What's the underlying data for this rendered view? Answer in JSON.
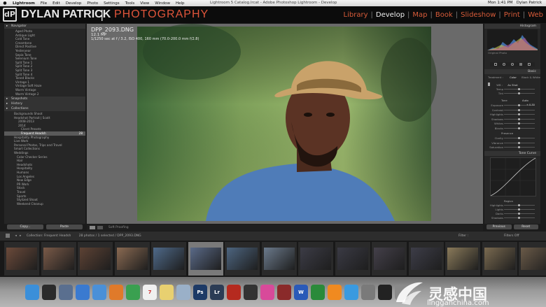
{
  "menubar": {
    "apple": "",
    "items": [
      "Lightroom",
      "File",
      "Edit",
      "Develop",
      "Photo",
      "Settings",
      "Tools",
      "View",
      "Window",
      "Help"
    ],
    "window_title": "Lightroom 5 Catalog.lrcat - Adobe Photoshop Lightroom - Develop",
    "clock": "Mon 1:41 PM",
    "user": "Dylan Patrick"
  },
  "identity_plate": {
    "logo_glyph": "dP",
    "name": "DYLAN PATRICK",
    "separator": "|",
    "subtitle": "PHOTOGRAPHY",
    "accent_color": "#e0553a"
  },
  "modules": [
    {
      "label": "Library",
      "active": false
    },
    {
      "label": "Develop",
      "active": true
    },
    {
      "label": "Map",
      "active": false
    },
    {
      "label": "Book",
      "active": false
    },
    {
      "label": "Slideshow",
      "active": false
    },
    {
      "label": "Print",
      "active": false
    },
    {
      "label": "Web",
      "active": false
    }
  ],
  "left_panel": {
    "navigator_header": "Navigator",
    "presets": [
      "Aged Photo",
      "Antique Light",
      "Cold Tone",
      "Creamtone",
      "Direct Positive",
      "Yesteryear",
      "Sepia Tone",
      "Selenium Tone",
      "Split Tone 1",
      "Split Tone 2",
      "Split Tone 3",
      "Split Tone 4",
      "Toned Blacks",
      "Vintage 1",
      "Vintage Soft Haze",
      "Warm Vintage",
      "Warm Vintage 2"
    ],
    "snapshots_header": "Snapshots",
    "history_header": "History",
    "collections_header": "Collections",
    "collections": [
      {
        "label": "Backgrounds Shoot",
        "count": ""
      },
      {
        "label": "Headshot Portrait | Scott",
        "count": ""
      },
      {
        "label": "2008-2013",
        "count": ""
      },
      {
        "label": "2014",
        "count": ""
      },
      {
        "label": "Client Presets",
        "count": ""
      },
      {
        "label": "Frequent Headsh",
        "count": "28"
      },
      {
        "label": "Hospitality Photography",
        "count": ""
      },
      {
        "label": "Live Work",
        "count": ""
      },
      {
        "label": "Personal Photos, Trips and Travel",
        "count": ""
      },
      {
        "label": "Smart Collections",
        "count": ""
      },
      {
        "label": "Weddings",
        "count": ""
      },
      {
        "label": "Color Checker Series",
        "count": ""
      },
      {
        "label": "Hair",
        "count": ""
      },
      {
        "label": "Headshots",
        "count": ""
      },
      {
        "label": "Hospitality",
        "count": ""
      },
      {
        "label": "Humans",
        "count": ""
      },
      {
        "label": "Los Angeles",
        "count": ""
      },
      {
        "label": "New Edge",
        "count": ""
      },
      {
        "label": "PR Work",
        "count": ""
      },
      {
        "label": "Stock",
        "count": ""
      },
      {
        "label": "Travel",
        "count": ""
      },
      {
        "label": "Sports",
        "count": ""
      },
      {
        "label": "Stylized Shoot",
        "count": ""
      },
      {
        "label": "Weekend Cleanup",
        "count": ""
      }
    ],
    "copy_button": "Copy...",
    "paste_button": "Paste"
  },
  "photo_info": {
    "filename": "DPP_2093.DNG",
    "megapixels": "12.1 MP",
    "exposure": "1/1250 sec at f / 3.2, ISO 400, 160 mm (70.0-200.0 mm f/2.8)"
  },
  "toolbar": {
    "soft_proofing": "Soft Proofing"
  },
  "right_panel": {
    "histogram_header": "Histogram",
    "histogram_caption": "Original Photo",
    "basic_header": "Basic",
    "treatment_label": "Treatment :",
    "color_option": "Color",
    "bw_option": "Black & White",
    "wb_label": "WB :",
    "wb_value": "As Shot",
    "temp_label": "Temp",
    "tint_label": "Tint",
    "tone_label": "Tone",
    "auto_label": "Auto",
    "sliders": [
      "Exposure",
      "Contrast",
      "Highlights",
      "Shadows",
      "Whites",
      "Blacks"
    ],
    "exposure_value": "+ 0.30",
    "presence_label": "Presence",
    "presence_sliders": [
      "Clarity",
      "Vibrance",
      "Saturation"
    ],
    "tone_curve_header": "Tone Curve",
    "region_label": "Region",
    "region_sliders": [
      "Highlights",
      "Lights",
      "Darks",
      "Shadows"
    ],
    "previous_button": "Previous",
    "reset_button": "Reset"
  },
  "filmstrip": {
    "source": "Collection: Frequent Headsh",
    "count_text": "28 photos / 1 selected / DPP_2093.DNG",
    "filter_label": "Filter :",
    "filter_value": "Filters Off",
    "thumbnail_count": 15,
    "selected_index": 5
  },
  "dock": {
    "icons": [
      "finder-icon",
      "dashboard-icon",
      "mission-control-icon",
      "safari-icon",
      "mail-icon",
      "firefox-icon",
      "chrome-icon",
      "calendar-icon",
      "notes-icon",
      "preview-icon",
      "photoshop-icon",
      "lightroom-icon",
      "filezilla-icon",
      "camranger-icon",
      "itunes-icon",
      "photo-booth-icon",
      "word-icon",
      "excel-icon",
      "vlc-icon",
      "app-store-icon",
      "system-preferences-icon",
      "terminal-icon",
      "trash-icon"
    ],
    "calendar_day": "7",
    "photoshop_label": "Ps",
    "lightroom_label": "Lr",
    "word_label": "W"
  },
  "watermark": {
    "text": "灵感中国",
    "url": "lingganchina.com"
  }
}
